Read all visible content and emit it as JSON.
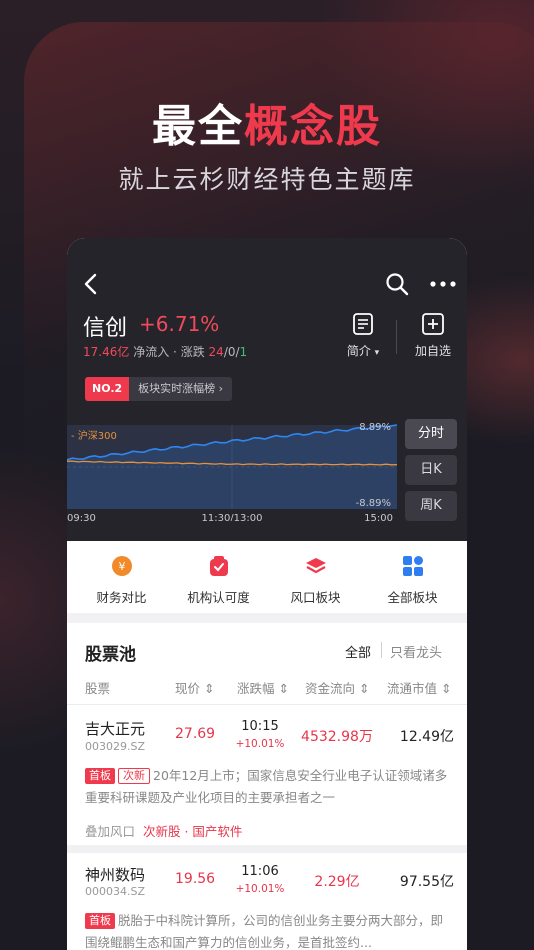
{
  "promo": {
    "headline_prefix": "最全",
    "headline_accent": "概念股",
    "subtitle": "就上云杉财经特色主题库"
  },
  "colors": {
    "accent": "#ef3a4e",
    "up": "#e8354a",
    "down_green": "#3ec07a",
    "dark_bg": "#25242b"
  },
  "header": {
    "back_icon": "chevron-left-icon",
    "search_icon": "search-icon",
    "more_icon": "more-dots-icon",
    "sector_name": "信创",
    "change_pct": "+6.71%",
    "net_inflow_value": "17.46亿",
    "net_inflow_label": "净流入",
    "dot": "·",
    "updown_label": "涨跌",
    "up_count": "24",
    "slash1": "/",
    "flat_count": "0",
    "slash2": "/",
    "down_count": "1",
    "intro_label": "简介",
    "intro_caret": "▾",
    "add_watch_label": "加自选"
  },
  "rank_badge": {
    "tag": "NO.2",
    "text": "板块实时涨幅榜 ›"
  },
  "intraday_chart": {
    "legend_index": "- 沪深300",
    "y_top_label": "8.89%",
    "y_bottom_label": "-8.89%",
    "x_labels": [
      "09:30",
      "11:30/13:00",
      "15:00"
    ],
    "period_buttons": [
      "分时",
      "日K",
      "周K"
    ]
  },
  "chart_data": {
    "type": "line",
    "title": "",
    "ylim": [
      -8.89,
      8.89
    ],
    "x": [
      "09:30",
      "11:30/13:00",
      "15:00"
    ],
    "series": [
      {
        "name": "信创",
        "values": [
          1.5,
          5.5,
          8.89
        ]
      },
      {
        "name": "沪深300",
        "values": [
          1.2,
          0.6,
          0.5
        ]
      }
    ]
  },
  "shortcuts": [
    {
      "label": "财务对比",
      "icon": "yuan-icon"
    },
    {
      "label": "机构认可度",
      "icon": "check-bag-icon"
    },
    {
      "label": "风口板块",
      "icon": "layers-icon"
    },
    {
      "label": "全部板块",
      "icon": "grid-icon"
    }
  ],
  "pool": {
    "title": "股票池",
    "filter_all": "全部",
    "filter_leader": "只看龙头",
    "columns": [
      "股票",
      "现价 ⇕",
      "涨跌幅 ⇕",
      "资金流向 ⇕",
      "流通市值 ⇕"
    ]
  },
  "stocks": [
    {
      "name": "吉大正元",
      "code": "003029.SZ",
      "price": "27.69",
      "time": "10:15",
      "change": "+10.01%",
      "flow": "4532.98万",
      "cap": "12.49亿",
      "badges": [
        "首板",
        "次新"
      ],
      "desc": "20年12月上市；国家信息安全行业电子认证领域诸多重要科研课题及产业化项目的主要承担者之一",
      "wind_label": "叠加风口",
      "wind_tags": "次新股 · 国产软件"
    },
    {
      "name": "神州数码",
      "code": "000034.SZ",
      "price": "19.56",
      "time": "11:06",
      "change": "+10.01%",
      "flow": "2.29亿",
      "cap": "97.55亿",
      "badges": [
        "首板"
      ],
      "desc": "脱胎于中科院计算所，公司的信创业务主要分两大部分，即围绕鲲鹏生态和国产算力的信创业务，是首批签约..."
    }
  ]
}
